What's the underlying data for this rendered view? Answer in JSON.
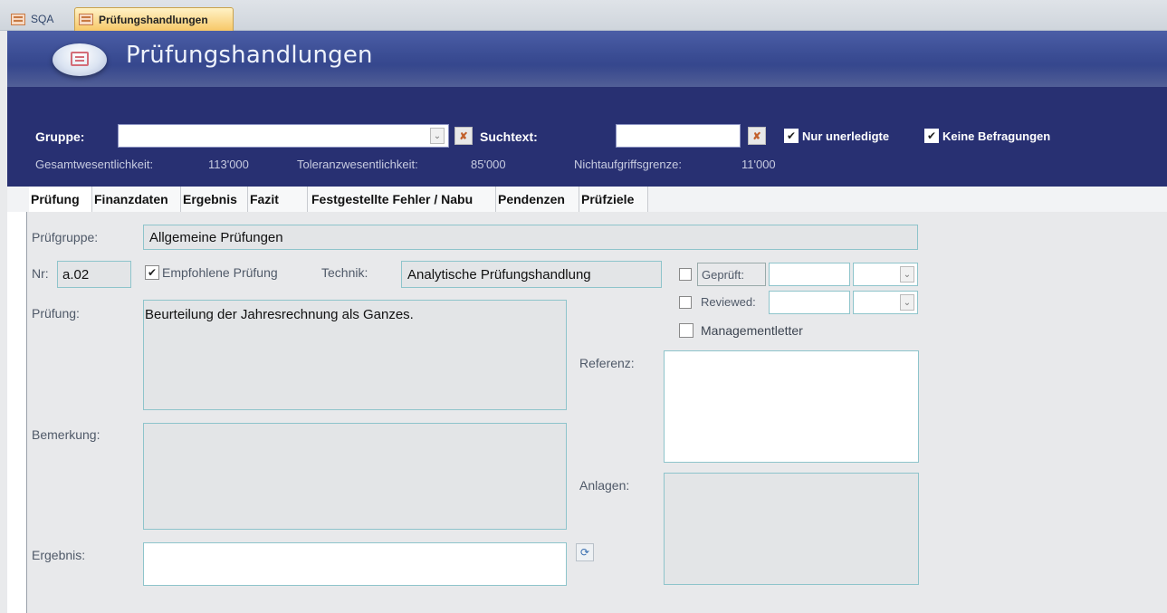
{
  "doc_tabs": [
    {
      "label": "SQA"
    },
    {
      "label": "Prüfungshandlungen"
    }
  ],
  "header": {
    "title": "Prüfungshandlungen",
    "gruppe_label": "Gruppe:",
    "gruppe_value": "",
    "suchtext_label": "Suchtext:",
    "suchtext_value": "",
    "nur_unerledigte": {
      "label": "Nur unerledigte",
      "checked": true
    },
    "keine_befragungen": {
      "label": "Keine Befragungen",
      "checked": true
    },
    "gesamtwesentlichkeit_label": "Gesamtwesentlichkeit:",
    "gesamtwesentlichkeit_value": "113'000",
    "toleranzwesentlichkeit_label": "Toleranzwesentlichkeit:",
    "toleranzwesentlichkeit_value": "85'000",
    "nichtaufgriffsgrenze_label": "Nichtaufgriffsgrenze:",
    "nichtaufgriffsgrenze_value": "11'000"
  },
  "form_tabs": [
    {
      "label": "Prüfung",
      "active": true
    },
    {
      "label": "Finanzdaten"
    },
    {
      "label": "Ergebnis"
    },
    {
      "label": "Fazit"
    },
    {
      "label": "Festgestellte Fehler / Nabu"
    },
    {
      "label": "Pendenzen"
    },
    {
      "label": "Prüfziele"
    }
  ],
  "detail": {
    "pruefgruppe_label": "Prüfgruppe:",
    "pruefgruppe_value": "Allgemeine Prüfungen",
    "nr_label": "Nr:",
    "nr_value": "a.02",
    "empfohlene_pruefung": {
      "label": "Empfohlene Prüfung",
      "checked": true
    },
    "technik_label": "Technik:",
    "technik_value": "Analytische Prüfungshandlung",
    "geprueft": {
      "label": "Geprüft:",
      "checked": false,
      "value": ""
    },
    "reviewed": {
      "label": "Reviewed:",
      "checked": false,
      "value": ""
    },
    "managementletter": {
      "label": "Managementletter",
      "checked": false
    },
    "pruefung_label": "Prüfung:",
    "pruefung_value": "Beurteilung der Jahresrechnung als Ganzes.",
    "referenz_label": "Referenz:",
    "referenz_value": "",
    "bemerkung_label": "Bemerkung:",
    "bemerkung_value": "",
    "anlagen_label": "Anlagen:",
    "anlagen_value": "",
    "ergebnis_label": "Ergebnis:",
    "ergebnis_value": ""
  }
}
